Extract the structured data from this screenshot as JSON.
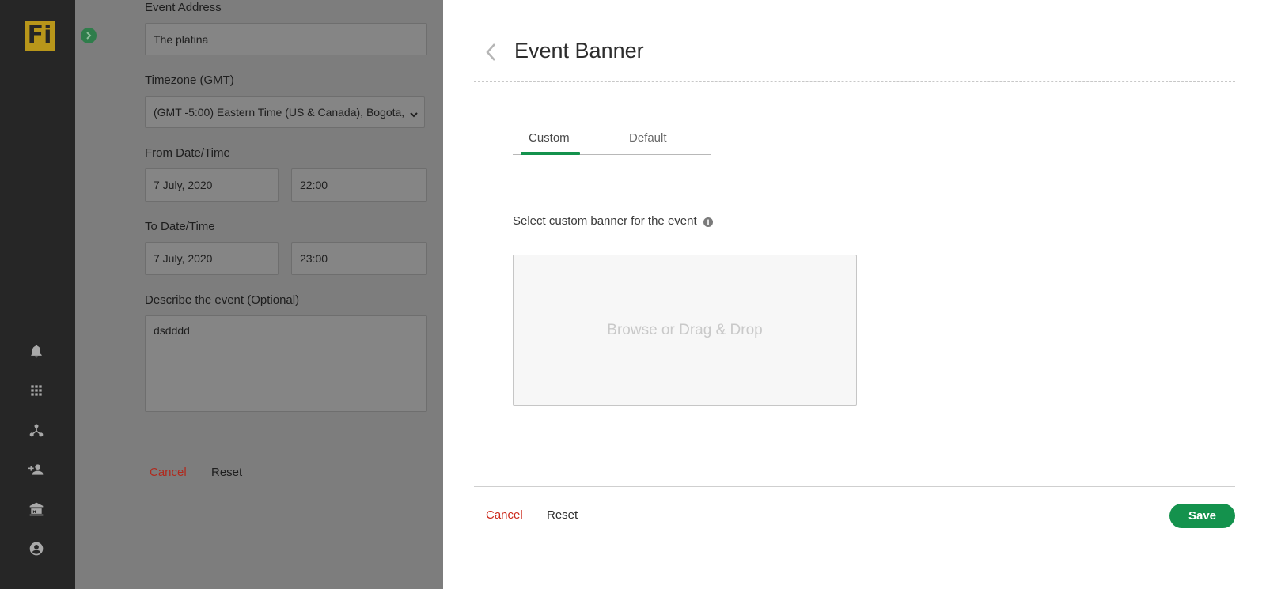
{
  "nav": {
    "logo": "Fi",
    "icons": [
      "bell-icon",
      "apps-grid-icon",
      "network-icon",
      "add-user-icon",
      "museum-icon",
      "account-circle-icon"
    ]
  },
  "form": {
    "address_label": "Event Address",
    "address_value": "The platina",
    "timezone_label": "Timezone (GMT)",
    "timezone_value": "(GMT -5:00) Eastern Time (US & Canada), Bogota,",
    "from_label": "From Date/Time",
    "from_date": "7 July, 2020",
    "from_time": "22:00",
    "to_label": "To Date/Time",
    "to_date": "7 July, 2020",
    "to_time": "23:00",
    "describe_label": "Describe the event (Optional)",
    "describe_value": "dsdddd",
    "cancel": "Cancel",
    "reset": "Reset"
  },
  "panel": {
    "title": "Event Banner",
    "tabs": [
      {
        "label": "Custom",
        "active": true
      },
      {
        "label": "Default",
        "active": false
      }
    ],
    "banner_label": "Select custom banner for the event",
    "dropzone_text": "Browse or Drag & Drop",
    "cancel": "Cancel",
    "reset": "Reset",
    "save": "Save"
  },
  "colors": {
    "accent": "#14924d",
    "danger": "#cc2a1c",
    "logo": "#b8961a",
    "nav_bg": "#262626"
  }
}
